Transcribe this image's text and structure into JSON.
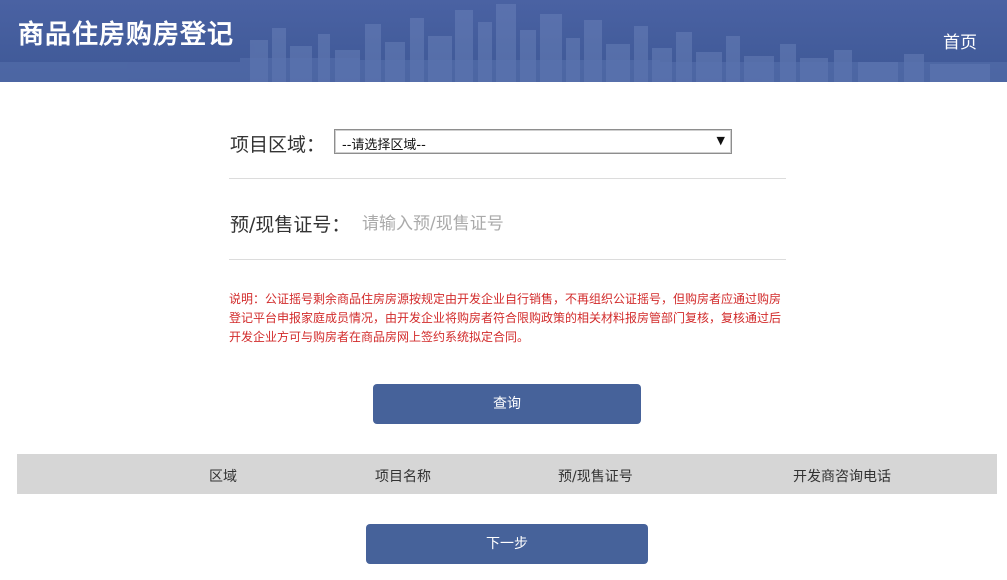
{
  "header": {
    "title": "商品住房购房登记",
    "home_link": "首页"
  },
  "form": {
    "region_label": "项目区域：",
    "region_select_value": "--请选择区域--",
    "cert_label": "预/现售证号：",
    "cert_placeholder": "请输入预/现售证号"
  },
  "note": {
    "text": "说明：公证摇号剩余商品住房房源按规定由开发企业自行销售，不再组织公证摇号，但购房者应通过购房登记平台申报家庭成员情况，由开发企业将购房者符合限购政策的相关材料报房管部门复核，复核通过后开发企业方可与购房者在商品房网上签约系统拟定合同。"
  },
  "buttons": {
    "query": "查询",
    "next": "下一步"
  },
  "table": {
    "columns": [
      "区域",
      "项目名称",
      "预/现售证号",
      "开发商咨询电话"
    ]
  },
  "colors": {
    "header_bg": "#4560a0",
    "button_bg": "#46629a",
    "note_text": "#d22b2b",
    "table_header_bg": "#d6d6d6"
  }
}
